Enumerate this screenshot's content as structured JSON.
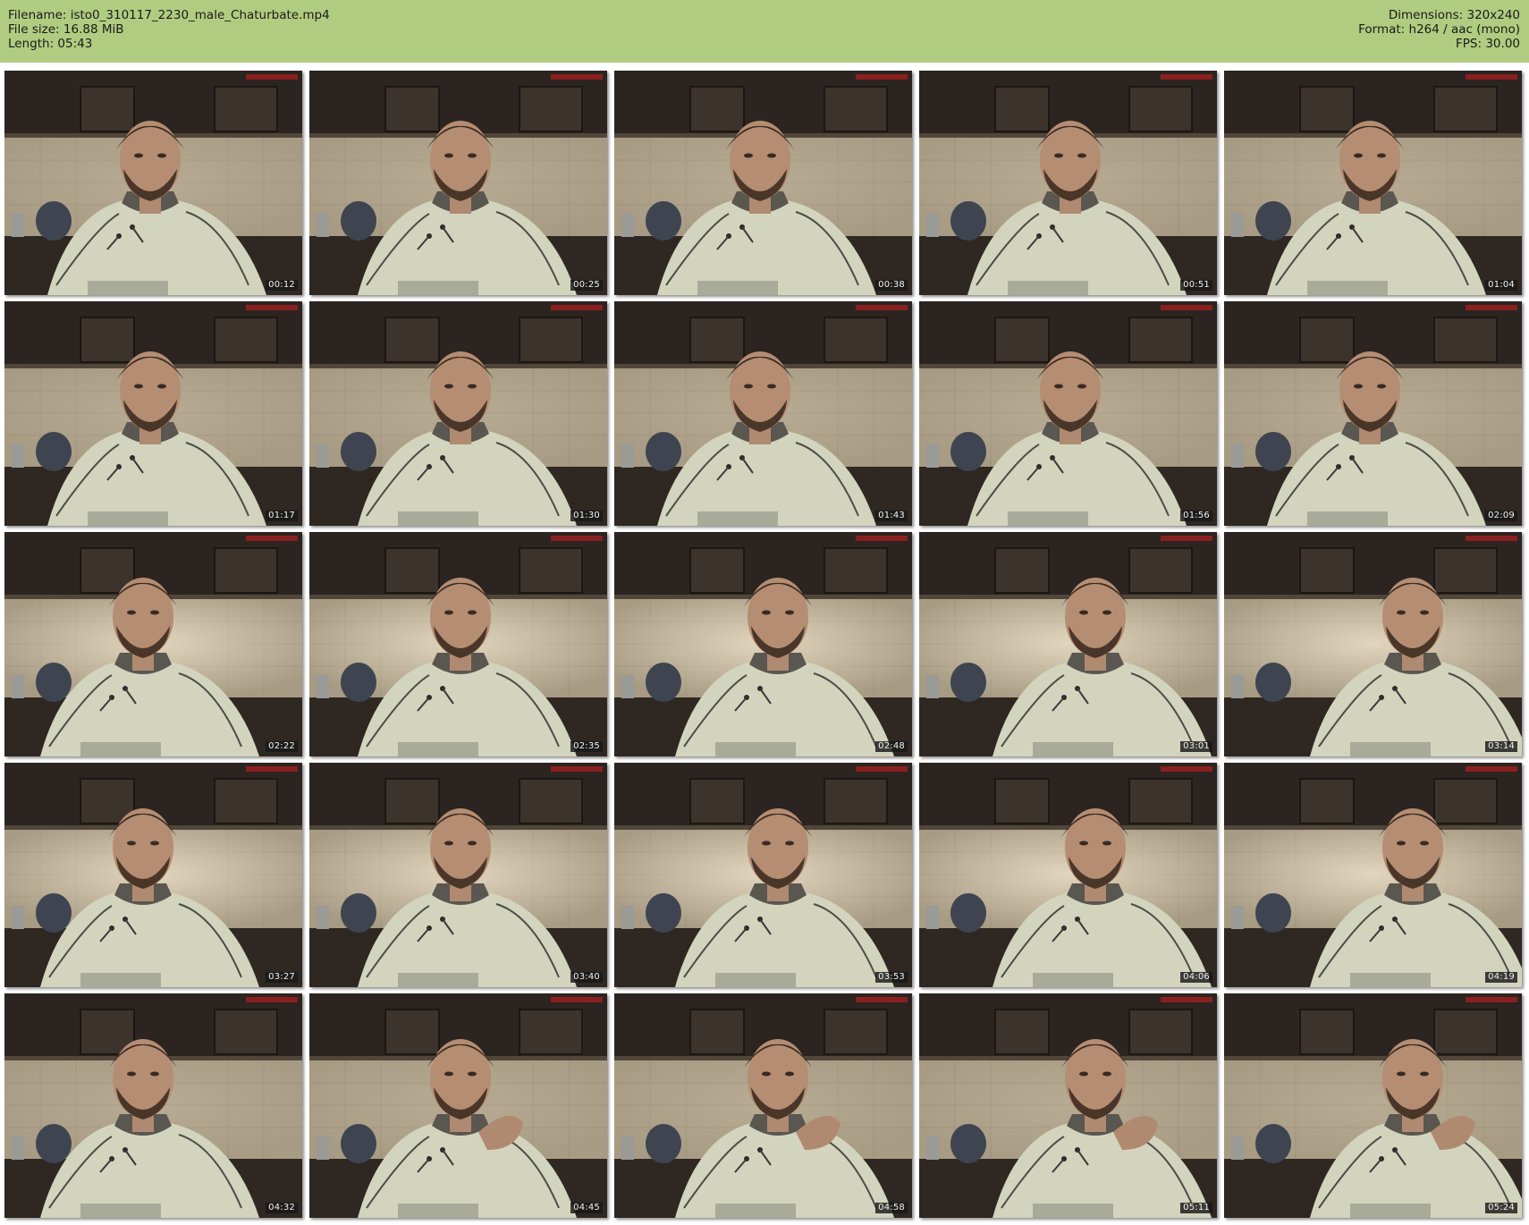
{
  "header": {
    "left": [
      "Filename: isto0_310117_2230_male_Chaturbate.mp4",
      "File size: 16.88 MiB",
      "Length: 05:43"
    ],
    "right": [
      "Dimensions: 320x240",
      "Format: h264 / aac (mono)",
      "FPS: 30.00"
    ],
    "background_color": "#b0cc80"
  },
  "thumbnails": [
    {
      "time": "00:12"
    },
    {
      "time": "00:25"
    },
    {
      "time": "00:38"
    },
    {
      "time": "00:51"
    },
    {
      "time": "01:04"
    },
    {
      "time": "01:17"
    },
    {
      "time": "01:30"
    },
    {
      "time": "01:43"
    },
    {
      "time": "01:56"
    },
    {
      "time": "02:09"
    },
    {
      "time": "02:22"
    },
    {
      "time": "02:35"
    },
    {
      "time": "02:48"
    },
    {
      "time": "03:01"
    },
    {
      "time": "03:14"
    },
    {
      "time": "03:27"
    },
    {
      "time": "03:40"
    },
    {
      "time": "03:53"
    },
    {
      "time": "04:06"
    },
    {
      "time": "04:19"
    },
    {
      "time": "04:32"
    },
    {
      "time": "04:45"
    },
    {
      "time": "04:58"
    },
    {
      "time": "05:11"
    },
    {
      "time": "05:24"
    }
  ]
}
